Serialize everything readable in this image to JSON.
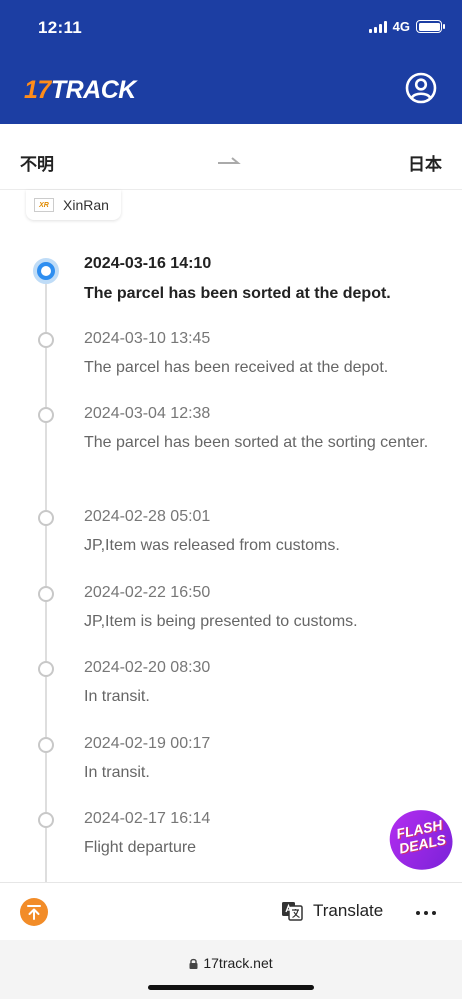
{
  "status_bar": {
    "time": "12:11",
    "network": "4G"
  },
  "header": {
    "logo_number": "17",
    "logo_text": "TRACK",
    "user_icon": "user-circle-icon"
  },
  "route": {
    "from": "不明",
    "to": "日本",
    "arrow_icon": "arrow-right-icon"
  },
  "carrier": {
    "logo_text": "XR",
    "name": "XinRan"
  },
  "events": [
    {
      "time": "2024-03-16 14:10",
      "desc": "The parcel has been sorted at the depot."
    },
    {
      "time": "2024-03-10 13:45",
      "desc": "The parcel has been received at the depot."
    },
    {
      "time": "2024-03-04 12:38",
      "desc": "The parcel has been sorted at the sorting center."
    },
    {
      "time": "2024-02-28 05:01",
      "desc": "JP,Item was released from customs."
    },
    {
      "time": "2024-02-22 16:50",
      "desc": "JP,Item is being presented to customs."
    },
    {
      "time": "2024-02-20 08:30",
      "desc": "In transit."
    },
    {
      "time": "2024-02-19 00:17",
      "desc": "In transit."
    },
    {
      "time": "2024-02-17 16:14",
      "desc": "Flight departure"
    }
  ],
  "promo": {
    "line1": "FLASH",
    "line2": "DEALS"
  },
  "toolbar": {
    "translate_label": "Translate",
    "top_icon": "arrow-to-top-icon",
    "translate_icon": "translate-icon",
    "more_icon": "more-dots-icon"
  },
  "browser": {
    "url": "17track.net",
    "lock_icon": "lock-icon"
  },
  "colors": {
    "brand_blue": "#1c3ea3",
    "accent_orange": "#ff8c1a",
    "active_dot": "#2e8ef0",
    "promo_purple": "#9b28e6"
  }
}
